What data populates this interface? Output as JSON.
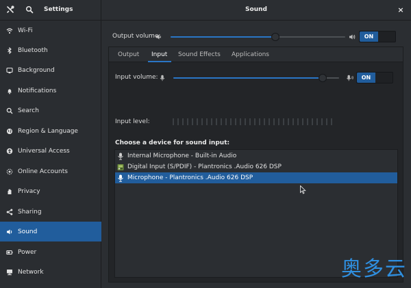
{
  "header": {
    "settings_title": "Settings",
    "panel_title": "Sound",
    "close_glyph": "×",
    "tools_icon": "tools-icon",
    "search_icon": "search-icon"
  },
  "sidebar": {
    "items": [
      {
        "label": "Wi-Fi",
        "icon": "wifi-icon"
      },
      {
        "label": "Bluetooth",
        "icon": "bluetooth-icon"
      },
      {
        "label": "Background",
        "icon": "background-icon"
      },
      {
        "label": "Notifications",
        "icon": "bell-icon"
      },
      {
        "label": "Search",
        "icon": "search-icon"
      },
      {
        "label": "Region & Language",
        "icon": "globe-icon"
      },
      {
        "label": "Universal Access",
        "icon": "universal-access-icon"
      },
      {
        "label": "Online Accounts",
        "icon": "online-accounts-icon"
      },
      {
        "label": "Privacy",
        "icon": "hand-icon"
      },
      {
        "label": "Sharing",
        "icon": "share-icon"
      },
      {
        "label": "Sound",
        "icon": "speaker-icon",
        "active": true
      },
      {
        "label": "Power",
        "icon": "power-icon"
      },
      {
        "label": "Network",
        "icon": "network-icon"
      }
    ]
  },
  "output": {
    "label": "Output volume:",
    "level": 0.6,
    "toggle": "ON"
  },
  "tabs": [
    {
      "label": "Output"
    },
    {
      "label": "Input",
      "active": true
    },
    {
      "label": "Sound Effects"
    },
    {
      "label": "Applications"
    }
  ],
  "input": {
    "volume_label": "Input volume:",
    "level": 0.9,
    "toggle": "ON",
    "level_label": "Input level:",
    "meter_level": 0
  },
  "devices": {
    "heading": "Choose a device for sound input:",
    "items": [
      {
        "label": "Internal Microphone - Built-in Audio",
        "icon": "microphone-icon"
      },
      {
        "label": "Digital Input (S/PDIF) - Plantronics .Audio 626 DSP",
        "icon": "digital-input-icon"
      },
      {
        "label": "Microphone - Plantronics .Audio 626 DSP",
        "icon": "microphone-icon",
        "selected": true
      }
    ]
  },
  "watermark": "奥多云",
  "colors": {
    "accent": "#215d9c",
    "slider_fill": "#2a76c6",
    "background": "#2b2e32"
  }
}
